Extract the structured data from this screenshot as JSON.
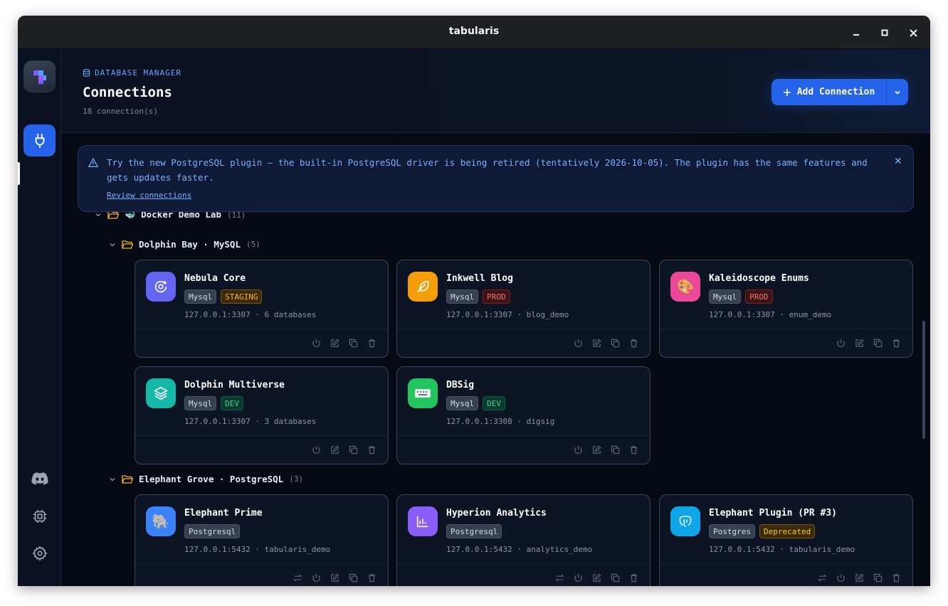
{
  "window": {
    "title": "tabularis"
  },
  "sidebar": {
    "logo_icon": "tabularis-logo-icon",
    "nav_items": [
      {
        "name": "connections",
        "icon": "plug-icon",
        "active": true
      },
      {
        "name": "discord",
        "icon": "discord-icon"
      },
      {
        "name": "plugins",
        "icon": "chip-icon"
      },
      {
        "name": "settings",
        "icon": "gear-icon"
      }
    ]
  },
  "header": {
    "eyebrow": "DATABASE MANAGER",
    "title": "Connections",
    "subtitle": "18 connection(s)",
    "add_button": "Add Connection"
  },
  "banner": {
    "message": "Try the new PostgreSQL plugin — the built-in PostgreSQL driver is being retired (tentatively 2026-10-05). The plugin has the same features and gets updates faster.",
    "link": "Review connections",
    "close": "✕"
  },
  "groups": [
    {
      "name": "🐳 Docker Demo Lab",
      "count": "(11)"
    },
    {
      "name": "Dolphin Bay · MySQL",
      "count": "(5)"
    },
    {
      "name": "Elephant Grove · PostgreSQL",
      "count": "(3)"
    }
  ],
  "cards": [
    {
      "name": "Nebula Core",
      "type": "Mysql",
      "env": "STAGING",
      "meta": "127.0.0.1:3307 · 6 databases",
      "icon": "orbit-icon",
      "color": "#6366f1"
    },
    {
      "name": "Inkwell Blog",
      "type": "Mysql",
      "env": "PROD",
      "meta": "127.0.0.1:3307 · blog_demo",
      "icon": "feather-icon",
      "color": "#f59e0b"
    },
    {
      "name": "Kaleidoscope Enums",
      "type": "Mysql",
      "env": "PROD",
      "meta": "127.0.0.1:3307 · enum_demo",
      "icon": "palette-icon",
      "color": "#ec4899"
    },
    {
      "name": "Dolphin Multiverse",
      "type": "Mysql",
      "env": "DEV",
      "meta": "127.0.0.1:3307 · 3 databases",
      "icon": "layers-icon",
      "color": "#14b8a6"
    },
    {
      "name": "DBSig",
      "type": "Mysql",
      "env": "DEV",
      "meta": "127.0.0.1:3308 · digsig",
      "icon": "keyboard-icon",
      "color": "#22c55e"
    },
    {
      "name": "Elephant Prime",
      "type": "Postgresql",
      "env": "",
      "meta": "127.0.0.1:5432 · tabularis_demo",
      "icon": "elephant-icon",
      "color": "#3b82f6"
    },
    {
      "name": "Hyperion Analytics",
      "type": "Postgresql",
      "env": "",
      "meta": "127.0.0.1:5432 · analytics_demo",
      "icon": "bar-chart-icon",
      "color": "#8b5cf6"
    },
    {
      "name": "Elephant Plugin (PR #3)",
      "type": "Postgres",
      "env": "Deprecated",
      "meta": "127.0.0.1:5432 · tabularis_demo",
      "icon": "postgres-icon",
      "color": "#0ea5e9"
    }
  ]
}
